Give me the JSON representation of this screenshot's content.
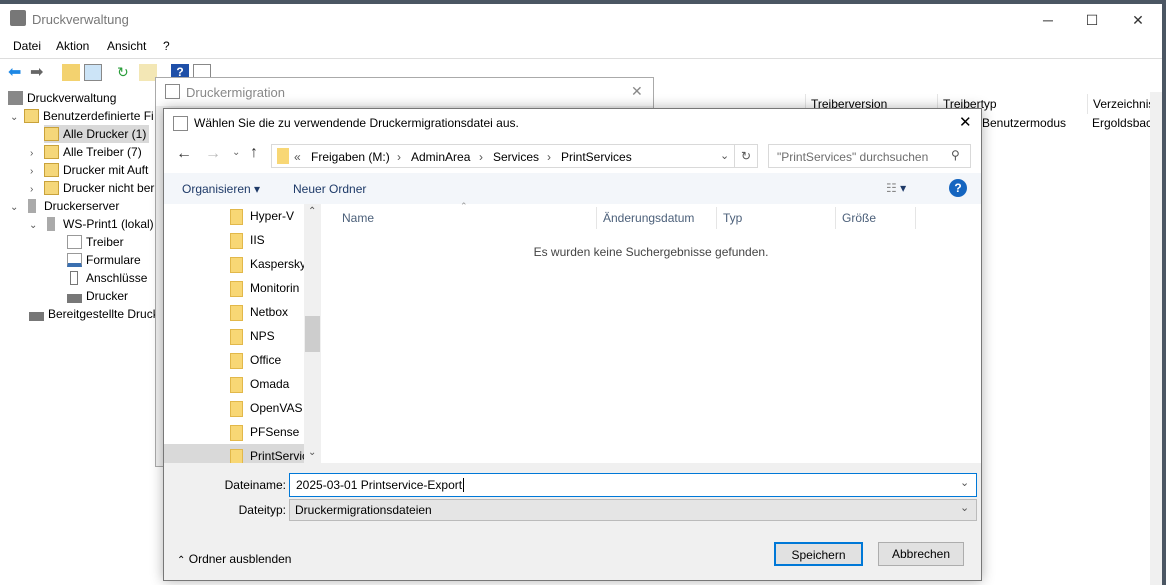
{
  "window": {
    "title": "Druckverwaltung",
    "minimize": "─",
    "maximize": "☐",
    "close": "✕"
  },
  "menu": [
    "Datei",
    "Aktion",
    "Ansicht",
    "?"
  ],
  "tree": [
    {
      "label": "Druckverwaltung",
      "icon": "print-management-icon"
    },
    {
      "label": "Benutzerdefinierte Fi",
      "icon": "filter-folder-icon",
      "expanded": true
    },
    {
      "label": "Alle Drucker (1)",
      "icon": "filter-folder-icon",
      "selected": true
    },
    {
      "label": "Alle Treiber (7)",
      "icon": "filter-folder-icon"
    },
    {
      "label": "Drucker mit Auft",
      "icon": "filter-folder-icon"
    },
    {
      "label": "Drucker nicht ber",
      "icon": "filter-folder-icon"
    },
    {
      "label": "Druckerserver",
      "icon": "server-icon",
      "expanded": true
    },
    {
      "label": "WS-Print1 (lokal)",
      "icon": "server-icon",
      "expanded": true
    },
    {
      "label": "Treiber",
      "icon": "driver-icon"
    },
    {
      "label": "Formulare",
      "icon": "forms-icon"
    },
    {
      "label": "Anschlüsse",
      "icon": "port-icon"
    },
    {
      "label": "Drucker",
      "icon": "printer-icon"
    },
    {
      "label": "Bereitgestellte Druck",
      "icon": "printer-icon"
    }
  ],
  "list": {
    "columns": [
      "Treiberversion",
      "Treibertyp",
      "Verzeichnis"
    ],
    "row": [
      "",
      "Benutzermodus",
      "Ergoldsbach;"
    ]
  },
  "wizard": {
    "title": "Druckermigration"
  },
  "dialog": {
    "title": "Wählen Sie die zu verwendende Druckermigrationsdatei aus.",
    "breadcrumb": [
      "«",
      "Freigaben (M:)",
      "AdminArea",
      "Services",
      "PrintServices"
    ],
    "search_placeholder": "\"PrintServices\" durchsuchen",
    "organize": "Organisieren",
    "new_folder": "Neuer Ordner",
    "nav": [
      "Hyper-V",
      "IIS",
      "Kaspersky",
      "Monitorin",
      "Netbox",
      "NPS",
      "Office",
      "Omada",
      "OpenVAS",
      "PFSense",
      "PrintServic"
    ],
    "columns": [
      "Name",
      "Änderungsdatum",
      "Typ",
      "Größe"
    ],
    "empty": "Es wurden keine Suchergebnisse gefunden.",
    "filename_label": "Dateiname:",
    "filename": "2025-03-01 Printservice-Export",
    "filetype_label": "Dateityp:",
    "filetype": "Druckermigrationsdateien",
    "hide_folders": "Ordner ausblenden",
    "save": "Speichern",
    "cancel": "Abbrechen"
  },
  "colors": {
    "accent": "#0078d7",
    "help": "#1565c0"
  }
}
